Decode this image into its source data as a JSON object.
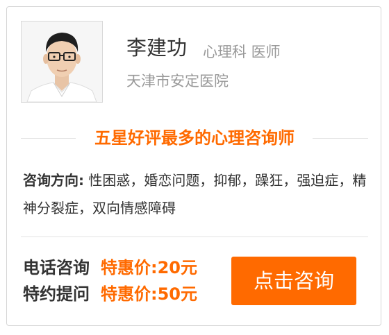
{
  "doctor": {
    "name": "李建功",
    "title": "心理科 医师",
    "hospital": "天津市安定医院"
  },
  "slogan": "五星好评最多的心理咨询师",
  "specialty": {
    "label": "咨询方向:",
    "text": "性困惑，婚恋问题，抑郁，躁狂，强迫症，精神分裂症，双向情感障碍"
  },
  "services": [
    {
      "name": "电话咨询",
      "price": "特惠价:20元"
    },
    {
      "name": "特约提问",
      "price": "特惠价:50元"
    }
  ],
  "consult_button": "点击咨询",
  "colors": {
    "accent": "#ff6a00",
    "text": "#333333",
    "muted": "#999999"
  }
}
